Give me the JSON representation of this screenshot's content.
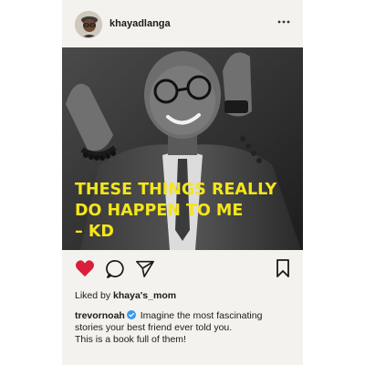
{
  "post": {
    "username": "khayadlanga",
    "more_icon": "more-horizontal-icon",
    "headline_lines": [
      "These things really",
      "do happen to me",
      "– KD"
    ],
    "actions": {
      "like_icon": "heart-filled-icon",
      "comment_icon": "comment-icon",
      "share_icon": "send-icon",
      "save_icon": "bookmark-icon"
    },
    "likes": {
      "prefix": "Liked by",
      "user": "khaya's_mom"
    },
    "caption": {
      "author": "trevornoah",
      "verified_icon": "verified-badge-icon",
      "line1": "Imagine the most fascinating",
      "line2": "stories your best friend ever told you.",
      "line3": "This is a book full of them!"
    }
  },
  "colors": {
    "headline": "#f5e61a",
    "like": "#d91f3c",
    "verified": "#3897f0",
    "cover_bg": "#f4f2ee"
  }
}
